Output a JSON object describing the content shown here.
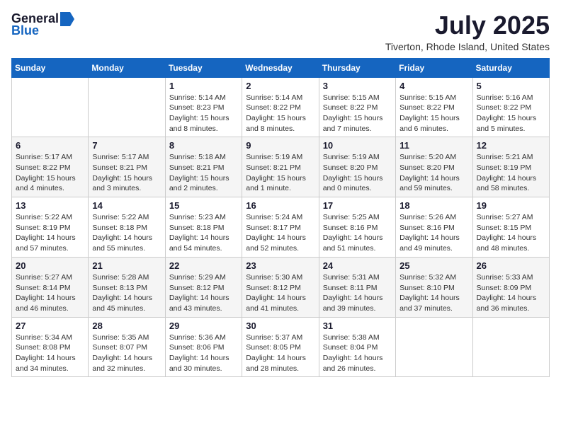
{
  "logo": {
    "general": "General",
    "blue": "Blue"
  },
  "title": "July 2025",
  "location": "Tiverton, Rhode Island, United States",
  "weekdays": [
    "Sunday",
    "Monday",
    "Tuesday",
    "Wednesday",
    "Thursday",
    "Friday",
    "Saturday"
  ],
  "weeks": [
    [
      {
        "day": "",
        "info": ""
      },
      {
        "day": "",
        "info": ""
      },
      {
        "day": "1",
        "info": "Sunrise: 5:14 AM\nSunset: 8:23 PM\nDaylight: 15 hours and 8 minutes."
      },
      {
        "day": "2",
        "info": "Sunrise: 5:14 AM\nSunset: 8:22 PM\nDaylight: 15 hours and 8 minutes."
      },
      {
        "day": "3",
        "info": "Sunrise: 5:15 AM\nSunset: 8:22 PM\nDaylight: 15 hours and 7 minutes."
      },
      {
        "day": "4",
        "info": "Sunrise: 5:15 AM\nSunset: 8:22 PM\nDaylight: 15 hours and 6 minutes."
      },
      {
        "day": "5",
        "info": "Sunrise: 5:16 AM\nSunset: 8:22 PM\nDaylight: 15 hours and 5 minutes."
      }
    ],
    [
      {
        "day": "6",
        "info": "Sunrise: 5:17 AM\nSunset: 8:22 PM\nDaylight: 15 hours and 4 minutes."
      },
      {
        "day": "7",
        "info": "Sunrise: 5:17 AM\nSunset: 8:21 PM\nDaylight: 15 hours and 3 minutes."
      },
      {
        "day": "8",
        "info": "Sunrise: 5:18 AM\nSunset: 8:21 PM\nDaylight: 15 hours and 2 minutes."
      },
      {
        "day": "9",
        "info": "Sunrise: 5:19 AM\nSunset: 8:21 PM\nDaylight: 15 hours and 1 minute."
      },
      {
        "day": "10",
        "info": "Sunrise: 5:19 AM\nSunset: 8:20 PM\nDaylight: 15 hours and 0 minutes."
      },
      {
        "day": "11",
        "info": "Sunrise: 5:20 AM\nSunset: 8:20 PM\nDaylight: 14 hours and 59 minutes."
      },
      {
        "day": "12",
        "info": "Sunrise: 5:21 AM\nSunset: 8:19 PM\nDaylight: 14 hours and 58 minutes."
      }
    ],
    [
      {
        "day": "13",
        "info": "Sunrise: 5:22 AM\nSunset: 8:19 PM\nDaylight: 14 hours and 57 minutes."
      },
      {
        "day": "14",
        "info": "Sunrise: 5:22 AM\nSunset: 8:18 PM\nDaylight: 14 hours and 55 minutes."
      },
      {
        "day": "15",
        "info": "Sunrise: 5:23 AM\nSunset: 8:18 PM\nDaylight: 14 hours and 54 minutes."
      },
      {
        "day": "16",
        "info": "Sunrise: 5:24 AM\nSunset: 8:17 PM\nDaylight: 14 hours and 52 minutes."
      },
      {
        "day": "17",
        "info": "Sunrise: 5:25 AM\nSunset: 8:16 PM\nDaylight: 14 hours and 51 minutes."
      },
      {
        "day": "18",
        "info": "Sunrise: 5:26 AM\nSunset: 8:16 PM\nDaylight: 14 hours and 49 minutes."
      },
      {
        "day": "19",
        "info": "Sunrise: 5:27 AM\nSunset: 8:15 PM\nDaylight: 14 hours and 48 minutes."
      }
    ],
    [
      {
        "day": "20",
        "info": "Sunrise: 5:27 AM\nSunset: 8:14 PM\nDaylight: 14 hours and 46 minutes."
      },
      {
        "day": "21",
        "info": "Sunrise: 5:28 AM\nSunset: 8:13 PM\nDaylight: 14 hours and 45 minutes."
      },
      {
        "day": "22",
        "info": "Sunrise: 5:29 AM\nSunset: 8:12 PM\nDaylight: 14 hours and 43 minutes."
      },
      {
        "day": "23",
        "info": "Sunrise: 5:30 AM\nSunset: 8:12 PM\nDaylight: 14 hours and 41 minutes."
      },
      {
        "day": "24",
        "info": "Sunrise: 5:31 AM\nSunset: 8:11 PM\nDaylight: 14 hours and 39 minutes."
      },
      {
        "day": "25",
        "info": "Sunrise: 5:32 AM\nSunset: 8:10 PM\nDaylight: 14 hours and 37 minutes."
      },
      {
        "day": "26",
        "info": "Sunrise: 5:33 AM\nSunset: 8:09 PM\nDaylight: 14 hours and 36 minutes."
      }
    ],
    [
      {
        "day": "27",
        "info": "Sunrise: 5:34 AM\nSunset: 8:08 PM\nDaylight: 14 hours and 34 minutes."
      },
      {
        "day": "28",
        "info": "Sunrise: 5:35 AM\nSunset: 8:07 PM\nDaylight: 14 hours and 32 minutes."
      },
      {
        "day": "29",
        "info": "Sunrise: 5:36 AM\nSunset: 8:06 PM\nDaylight: 14 hours and 30 minutes."
      },
      {
        "day": "30",
        "info": "Sunrise: 5:37 AM\nSunset: 8:05 PM\nDaylight: 14 hours and 28 minutes."
      },
      {
        "day": "31",
        "info": "Sunrise: 5:38 AM\nSunset: 8:04 PM\nDaylight: 14 hours and 26 minutes."
      },
      {
        "day": "",
        "info": ""
      },
      {
        "day": "",
        "info": ""
      }
    ]
  ]
}
